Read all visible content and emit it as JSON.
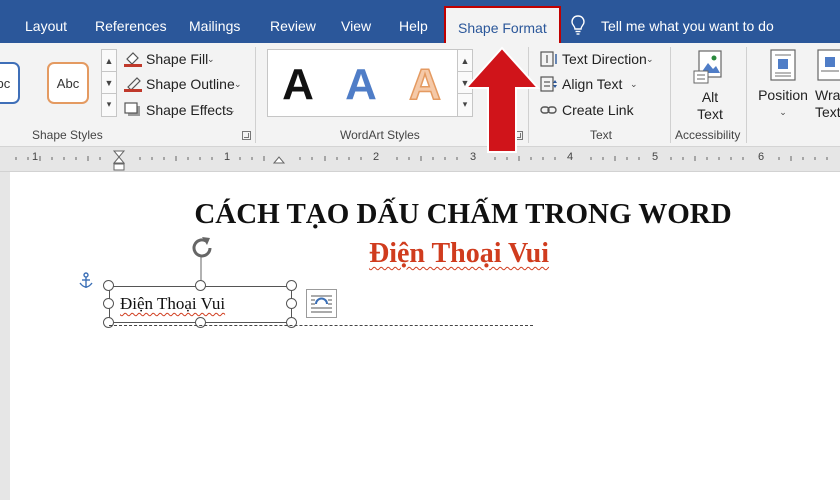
{
  "tabs": [
    {
      "label": "Layout",
      "active": false
    },
    {
      "label": "References",
      "active": false
    },
    {
      "label": "Mailings",
      "active": false
    },
    {
      "label": "Review",
      "active": false
    },
    {
      "label": "View",
      "active": false
    },
    {
      "label": "Help",
      "active": false
    },
    {
      "label": "Shape Format",
      "active": true
    }
  ],
  "tell_me": "Tell me what you want to do",
  "ribbon": {
    "shape_styles": {
      "label": "Shape Styles",
      "thumbs": [
        "Abc",
        "Abc"
      ],
      "commands": [
        "Shape Fill",
        "Shape Outline",
        "Shape Effects"
      ]
    },
    "wordart_styles": {
      "label": "WordArt Styles",
      "letters": [
        "A",
        "A",
        "A"
      ]
    },
    "text": {
      "label": "Text",
      "commands": [
        "Text Direction",
        "Align Text",
        "Create Link"
      ]
    },
    "accessibility": {
      "label": "Accessibility",
      "alt_text_line1": "Alt",
      "alt_text_line2": "Text"
    },
    "arrange": {
      "position": "Position",
      "wrap_line1": "Wra",
      "wrap_line2": "Text"
    }
  },
  "ruler_numbers": [
    "1",
    "1",
    "2",
    "3",
    "4",
    "5",
    "6"
  ],
  "document": {
    "title": "CÁCH TẠO DẤU CHẤM TRONG WORD",
    "subtitle": "Điện Thoại Vui",
    "textbox_text": "Điện Thoại Vui"
  },
  "colors": {
    "ribbon_tab_bar": "#2b579a",
    "highlight_box": "#c00000",
    "arrow": "#d0141a",
    "subtitle": "#d03c1e"
  },
  "icons": [
    "lightbulb-icon",
    "shape-fill-icon",
    "shape-outline-icon",
    "shape-effects-icon",
    "text-direction-icon",
    "align-text-icon",
    "create-link-icon",
    "alt-text-icon",
    "position-icon",
    "wrap-text-icon",
    "anchor-icon",
    "rotate-handle-icon",
    "layout-options-icon",
    "red-up-arrow-icon"
  ]
}
